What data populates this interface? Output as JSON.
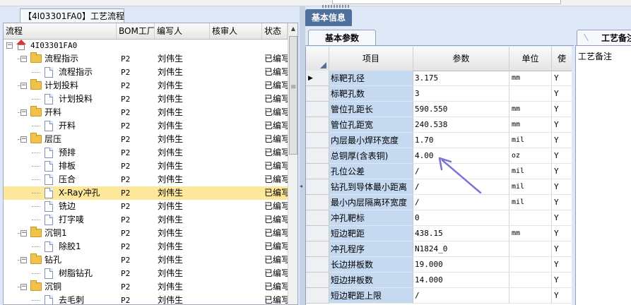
{
  "left_panel": {
    "tab_title": "【4I03301FA0】工艺流程",
    "columns": [
      "流程",
      "BOM工厂",
      "编写人",
      "核审人",
      "状态"
    ],
    "rows": [
      {
        "level": 0,
        "icon": "house",
        "expander": "−",
        "name": "4I03301FA0",
        "bom": "",
        "writer": "",
        "reviewer": "",
        "status": ""
      },
      {
        "level": 1,
        "icon": "folder",
        "expander": "−",
        "name": "流程指示",
        "bom": "P2",
        "writer": "刘伟生",
        "reviewer": "",
        "status": "已编写"
      },
      {
        "level": 2,
        "icon": "doc",
        "name": "流程指示",
        "bom": "P2",
        "writer": "刘伟生",
        "reviewer": "",
        "status": "已编写"
      },
      {
        "level": 1,
        "icon": "folder",
        "expander": "−",
        "name": "计划投料",
        "bom": "P2",
        "writer": "刘伟生",
        "reviewer": "",
        "status": "已编写"
      },
      {
        "level": 2,
        "icon": "doc",
        "name": "计划投料",
        "bom": "P2",
        "writer": "刘伟生",
        "reviewer": "",
        "status": "已编写"
      },
      {
        "level": 1,
        "icon": "folder",
        "expander": "−",
        "name": "开料",
        "bom": "P2",
        "writer": "刘伟生",
        "reviewer": "",
        "status": "已编写"
      },
      {
        "level": 2,
        "icon": "doc",
        "name": "开料",
        "bom": "P2",
        "writer": "刘伟生",
        "reviewer": "",
        "status": "已编写"
      },
      {
        "level": 1,
        "icon": "folder",
        "expander": "−",
        "name": "层压",
        "bom": "P2",
        "writer": "刘伟生",
        "reviewer": "",
        "status": "已编写"
      },
      {
        "level": 2,
        "icon": "doc",
        "name": "预排",
        "bom": "P2",
        "writer": "刘伟生",
        "reviewer": "",
        "status": "已编写"
      },
      {
        "level": 2,
        "icon": "doc",
        "name": "排板",
        "bom": "P2",
        "writer": "刘伟生",
        "reviewer": "",
        "status": "已编写"
      },
      {
        "level": 2,
        "icon": "doc",
        "name": "压合",
        "bom": "P2",
        "writer": "刘伟生",
        "reviewer": "",
        "status": "已编写"
      },
      {
        "level": 2,
        "icon": "doc",
        "name": "X-Ray冲孔",
        "bom": "P2",
        "writer": "刘伟生",
        "reviewer": "",
        "status": "已编写",
        "selected": true
      },
      {
        "level": 2,
        "icon": "doc",
        "name": "铣边",
        "bom": "P2",
        "writer": "刘伟生",
        "reviewer": "",
        "status": "已编写"
      },
      {
        "level": 2,
        "icon": "doc",
        "name": "打字唛",
        "bom": "P2",
        "writer": "刘伟生",
        "reviewer": "",
        "status": "已编写"
      },
      {
        "level": 1,
        "icon": "folder",
        "expander": "−",
        "name": "沉铜1",
        "bom": "P2",
        "writer": "刘伟生",
        "reviewer": "",
        "status": "已编写"
      },
      {
        "level": 2,
        "icon": "doc",
        "name": "除胶1",
        "bom": "P2",
        "writer": "刘伟生",
        "reviewer": "",
        "status": "已编写"
      },
      {
        "level": 1,
        "icon": "folder",
        "expander": "−",
        "name": "钻孔",
        "bom": "P2",
        "writer": "刘伟生",
        "reviewer": "",
        "status": "已编写"
      },
      {
        "level": 2,
        "icon": "doc",
        "name": "树脂钻孔",
        "bom": "P2",
        "writer": "刘伟生",
        "reviewer": "",
        "status": "已编写"
      },
      {
        "level": 1,
        "icon": "folder",
        "expander": "−",
        "name": "沉铜",
        "bom": "P2",
        "writer": "刘伟生",
        "reviewer": "",
        "status": "已编写"
      },
      {
        "level": 2,
        "icon": "doc",
        "name": "去毛刺",
        "bom": "P2",
        "writer": "刘伟生",
        "reviewer": "",
        "status": "已编写"
      }
    ]
  },
  "main": {
    "base_tab": "基本信息",
    "param_tab": "基本参数",
    "columns": [
      "项目",
      "参数",
      "单位",
      "使"
    ],
    "current_row_marker": "▶",
    "rows": [
      {
        "item": "标靶孔径",
        "value": "3.175",
        "unit": "mm",
        "flag": "Y"
      },
      {
        "item": "标靶孔数",
        "value": "3",
        "unit": "",
        "flag": "Y"
      },
      {
        "item": "管位孔距长",
        "value": "590.550",
        "unit": "mm",
        "flag": "Y"
      },
      {
        "item": "管位孔距宽",
        "value": "240.538",
        "unit": "mm",
        "flag": "Y"
      },
      {
        "item": "内层最小焊环宽度",
        "value": "1.70",
        "unit": "mil",
        "flag": "Y"
      },
      {
        "item": "总铜厚(含表铜)",
        "value": "4.00",
        "unit": "oz",
        "flag": "Y"
      },
      {
        "item": "孔位公差",
        "value": "/",
        "unit": "mil",
        "flag": "Y"
      },
      {
        "item": "钻孔到导体最小距离",
        "value": "/",
        "unit": "mil",
        "flag": "Y"
      },
      {
        "item": "最小内层隔离环宽度",
        "value": "/",
        "unit": "mil",
        "flag": "Y"
      },
      {
        "item": "冲孔靶标",
        "value": "0",
        "unit": "",
        "flag": "Y"
      },
      {
        "item": "短边靶距",
        "value": "438.15",
        "unit": "mm",
        "flag": "Y"
      },
      {
        "item": "冲孔程序",
        "value": "N1824_0",
        "unit": "",
        "flag": "Y"
      },
      {
        "item": "长边拼板数",
        "value": "19.000",
        "unit": "",
        "flag": "Y"
      },
      {
        "item": "短边拼板数",
        "value": "14.000",
        "unit": "",
        "flag": "Y"
      },
      {
        "item": "短边靶距上限",
        "value": "/",
        "unit": "",
        "flag": "Y"
      }
    ]
  },
  "notes_panel": {
    "tab_title": "工艺备注",
    "label": "工艺备注"
  },
  "colors": {
    "selected_row": "#fde79a",
    "item_cell": "#c5d9f1",
    "tab_active": "#4f6f9c",
    "annotation_arrow": "#7b72d6"
  }
}
